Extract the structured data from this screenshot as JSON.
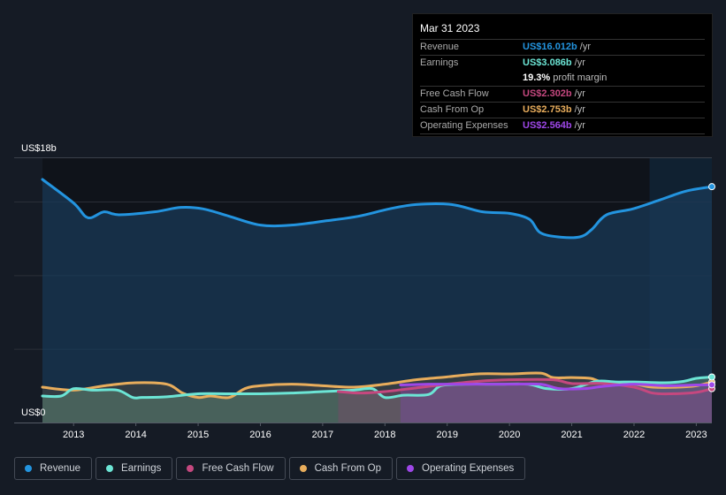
{
  "tooltip": {
    "date": "Mar 31 2023",
    "rows": [
      {
        "label": "Revenue",
        "value": "US$16.012b",
        "unit": "/yr",
        "color": "#2394df"
      },
      {
        "label": "Earnings",
        "value": "US$3.086b",
        "unit": "/yr",
        "color": "#6ce5d5"
      },
      {
        "label": "",
        "value": "19.3%",
        "unit": "profit margin",
        "color": "#ffffff"
      },
      {
        "label": "Free Cash Flow",
        "value": "US$2.302b",
        "unit": "/yr",
        "color": "#c5487f"
      },
      {
        "label": "Cash From Op",
        "value": "US$2.753b",
        "unit": "/yr",
        "color": "#e8ad5c"
      },
      {
        "label": "Operating Expenses",
        "value": "US$2.564b",
        "unit": "/yr",
        "color": "#9e47e8"
      }
    ]
  },
  "legend": [
    {
      "label": "Revenue",
      "color": "#2394df"
    },
    {
      "label": "Earnings",
      "color": "#6ce5d5"
    },
    {
      "label": "Free Cash Flow",
      "color": "#c5487f"
    },
    {
      "label": "Cash From Op",
      "color": "#e8ad5c"
    },
    {
      "label": "Operating Expenses",
      "color": "#9e47e8"
    }
  ],
  "chart_data": {
    "type": "area",
    "title": "",
    "xlabel": "",
    "ylabel": "",
    "y_tick_labels": [
      "US$0",
      "US$18b"
    ],
    "x_tick_labels": [
      "2013",
      "2014",
      "2015",
      "2016",
      "2017",
      "2018",
      "2019",
      "2020",
      "2021",
      "2022",
      "2023"
    ],
    "ylim": [
      0,
      18
    ],
    "xlim": [
      2012.5,
      2023.25
    ],
    "grid": true,
    "highlight_range": [
      2022.25,
      2023.25
    ],
    "series": [
      {
        "name": "Revenue",
        "color": "#2394df",
        "x": [
          2012.5,
          2013.0,
          2013.23,
          2013.49,
          2013.73,
          2014.3,
          2014.72,
          2015.08,
          2015.5,
          2016.0,
          2016.5,
          2017.07,
          2017.57,
          2018.07,
          2018.5,
          2019.07,
          2019.57,
          2020.0,
          2020.32,
          2020.49,
          2020.78,
          2021.13,
          2021.32,
          2021.56,
          2021.98,
          2022.41,
          2022.83,
          2023.25
        ],
        "values": [
          16.5,
          14.9,
          13.9,
          14.3,
          14.1,
          14.3,
          14.6,
          14.5,
          14.0,
          13.4,
          13.4,
          13.7,
          14.0,
          14.5,
          14.8,
          14.8,
          14.3,
          14.2,
          13.8,
          12.9,
          12.6,
          12.6,
          13.1,
          14.1,
          14.5,
          15.1,
          15.7,
          16.01
        ]
      },
      {
        "name": "Earnings",
        "color": "#6ce5d5",
        "x": [
          2012.5,
          2012.8,
          2013.0,
          2013.3,
          2013.7,
          2013.95,
          2014.1,
          2014.5,
          2015.0,
          2015.5,
          2016.0,
          2016.5,
          2017.0,
          2017.5,
          2017.8,
          2018.0,
          2018.3,
          2018.7,
          2018.9,
          2019.3,
          2019.8,
          2020.3,
          2020.6,
          2021.0,
          2021.4,
          2021.7,
          2022.0,
          2022.5,
          2022.8,
          2023.0,
          2023.25
        ],
        "values": [
          1.8,
          1.8,
          2.3,
          2.2,
          2.2,
          1.7,
          1.7,
          1.75,
          1.95,
          1.95,
          1.95,
          2.0,
          2.1,
          2.2,
          2.3,
          1.7,
          1.85,
          1.9,
          2.5,
          2.6,
          2.6,
          2.6,
          2.3,
          2.3,
          2.8,
          2.75,
          2.75,
          2.7,
          2.8,
          3.0,
          3.09
        ]
      },
      {
        "name": "Free Cash Flow",
        "color": "#c5487f",
        "x": [
          2017.25,
          2017.6,
          2018.0,
          2018.5,
          2019.0,
          2019.5,
          2020.0,
          2020.7,
          2021.0,
          2021.5,
          2022.0,
          2022.3,
          2022.6,
          2023.0,
          2023.25
        ],
        "values": [
          2.1,
          2.0,
          2.1,
          2.35,
          2.6,
          2.8,
          2.9,
          2.9,
          2.65,
          2.65,
          2.4,
          2.0,
          1.95,
          2.05,
          2.3
        ]
      },
      {
        "name": "Cash From Op",
        "color": "#e8ad5c",
        "x": [
          2012.5,
          2013.0,
          2013.5,
          2014.0,
          2014.5,
          2014.75,
          2015.0,
          2015.2,
          2015.5,
          2015.75,
          2016.0,
          2016.5,
          2017.0,
          2017.5,
          2018.0,
          2018.5,
          2019.0,
          2019.5,
          2020.0,
          2020.5,
          2020.7,
          2021.0,
          2021.3,
          2021.5,
          2022.0,
          2022.3,
          2022.7,
          2023.0,
          2023.25
        ],
        "values": [
          2.4,
          2.2,
          2.5,
          2.7,
          2.6,
          2.0,
          1.7,
          1.8,
          1.7,
          2.3,
          2.5,
          2.6,
          2.5,
          2.4,
          2.6,
          2.9,
          3.1,
          3.3,
          3.3,
          3.35,
          3.05,
          3.05,
          3.0,
          2.75,
          2.6,
          2.4,
          2.4,
          2.5,
          2.75
        ]
      },
      {
        "name": "Operating Expenses",
        "color": "#9e47e8",
        "x": [
          2018.25,
          2018.7,
          2019.0,
          2019.5,
          2020.0,
          2020.5,
          2020.8,
          2021.2,
          2021.5,
          2022.0,
          2022.5,
          2023.0,
          2023.25
        ],
        "values": [
          2.55,
          2.6,
          2.6,
          2.6,
          2.6,
          2.6,
          2.3,
          2.3,
          2.45,
          2.6,
          2.5,
          2.55,
          2.56
        ]
      }
    ]
  }
}
